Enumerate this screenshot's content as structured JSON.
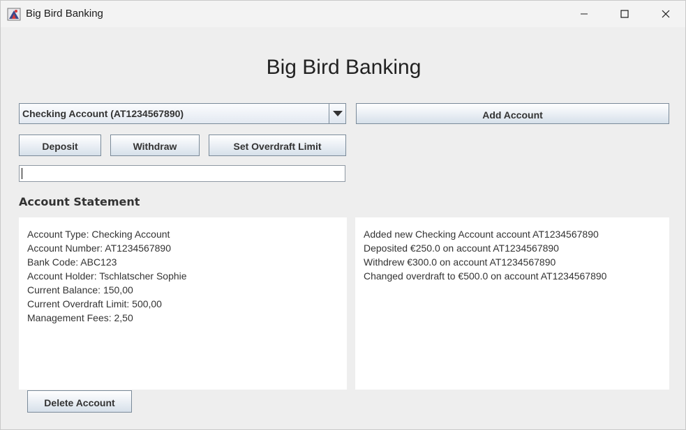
{
  "window": {
    "title": "Big Bird Banking",
    "controls": {
      "minimize_icon": "minimize-icon",
      "maximize_icon": "maximize-icon",
      "close_icon": "close-icon"
    }
  },
  "header": {
    "title": "Big Bird Banking"
  },
  "account_selector": {
    "selected": "Checking Account (AT1234567890)",
    "arrow_icon": "dropdown-arrow-icon"
  },
  "buttons": {
    "add_account": "Add Account",
    "deposit": "Deposit",
    "withdraw": "Withdraw",
    "set_overdraft": "Set Overdraft Limit",
    "delete_account": "Delete Account"
  },
  "amount_input": {
    "value": ""
  },
  "statement": {
    "label": "Account Statement",
    "details": [
      "Account Type: Checking Account",
      "Account Number: AT1234567890",
      "Bank Code: ABC123",
      "Account Holder: Tschlatscher Sophie",
      "Current Balance: 150,00",
      "Current Overdraft Limit: 500,00",
      "Management Fees: 2,50"
    ],
    "log": [
      "Added new Checking Account account AT1234567890",
      "Deposited €250.0 on account AT1234567890",
      "Withdrew €300.0 on account AT1234567890",
      "Changed overdraft to €500.0 on account AT1234567890"
    ]
  },
  "colors": {
    "window_bg": "#eeeeee",
    "panel_bg": "#ffffff",
    "button_border": "#7a8a99",
    "text": "#333333"
  }
}
